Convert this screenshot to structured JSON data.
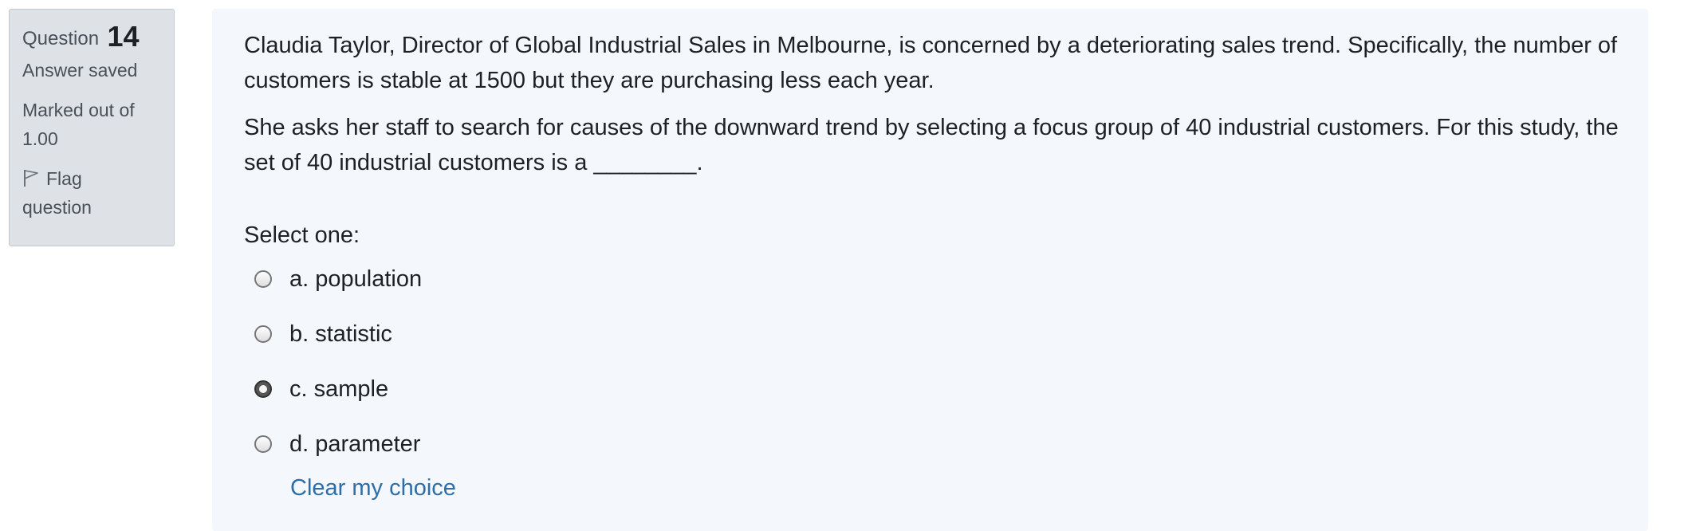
{
  "info": {
    "question_label": "Question",
    "question_number": "14",
    "state": "Answer saved",
    "grade_line1": "Marked out of",
    "grade_line2": "1.00",
    "flag_line1": "Flag",
    "flag_line2": "question"
  },
  "question": {
    "paragraph1": "Claudia Taylor, Director of Global Industrial Sales in Melbourne, is concerned by a deteriorating sales trend. Specifically, the number of customers is stable at 1500 but they are purchasing less each year.",
    "paragraph2": "She asks her staff to search for causes of the downward trend by selecting a focus group of 40 industrial customers. For this study, the set of 40 industrial customers is a ________.",
    "prompt": "Select one:",
    "options": [
      {
        "label": "a. population",
        "selected": false
      },
      {
        "label": "b. statistic",
        "selected": false
      },
      {
        "label": "c. sample",
        "selected": true
      },
      {
        "label": "d. parameter",
        "selected": false
      }
    ],
    "clear_label": "Clear my choice"
  }
}
